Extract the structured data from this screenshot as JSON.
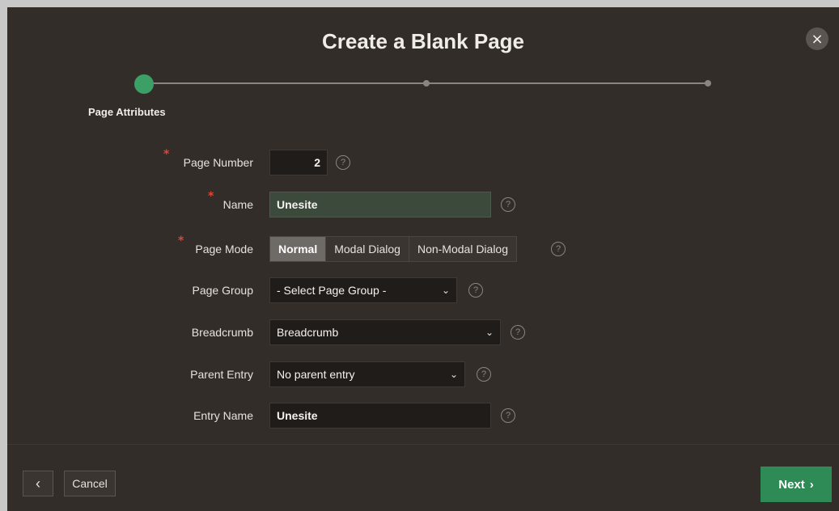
{
  "dialog": {
    "title": "Create a Blank Page",
    "close_icon": "×"
  },
  "wizard": {
    "current_step_label": "Page Attributes"
  },
  "form": {
    "page_number": {
      "label": "Page Number",
      "value": "2",
      "required": true
    },
    "name": {
      "label": "Name",
      "value": "Unesite",
      "required": true
    },
    "page_mode": {
      "label": "Page Mode",
      "required": true,
      "options": [
        "Normal",
        "Modal Dialog",
        "Non-Modal Dialog"
      ],
      "selected": "Normal"
    },
    "page_group": {
      "label": "Page Group",
      "value": "- Select Page Group -"
    },
    "breadcrumb": {
      "label": "Breadcrumb",
      "value": "Breadcrumb"
    },
    "parent_entry": {
      "label": "Parent Entry",
      "value": "No parent entry"
    },
    "entry_name": {
      "label": "Entry Name",
      "value": "Unesite"
    },
    "required_marker": "*",
    "help_glyph": "?"
  },
  "footer": {
    "back_icon": "‹",
    "cancel_label": "Cancel",
    "next_label": "Next",
    "next_icon": "›"
  },
  "icons": {
    "close": "close-icon",
    "help": "help-icon",
    "chevron": "chevron-down-icon",
    "back": "chevron-left-icon",
    "forward": "chevron-right-icon"
  },
  "colors": {
    "dialog_bg": "#322d29",
    "accent_green": "#3c9f65",
    "next_button": "#2e8b55",
    "required": "#e0453a",
    "selected_segment": "#6e6a66"
  }
}
